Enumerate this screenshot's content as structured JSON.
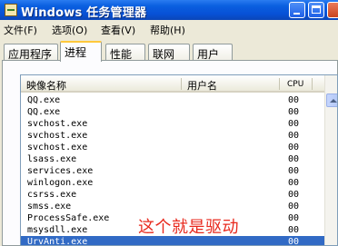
{
  "window": {
    "title": "Windows 任务管理器"
  },
  "menu": [
    {
      "label": "文件(F)"
    },
    {
      "label": "选项(O)"
    },
    {
      "label": "查看(V)"
    },
    {
      "label": "帮助(H)"
    }
  ],
  "tabs": [
    {
      "label": "应用程序"
    },
    {
      "label": "进程",
      "active": true
    },
    {
      "label": "性能"
    },
    {
      "label": "联网"
    },
    {
      "label": "用户"
    }
  ],
  "columns": {
    "image_name": "映像名称",
    "user_name": "用户名",
    "cpu": "CPU"
  },
  "processes": [
    {
      "name": "QQ.exe",
      "cpu": "00"
    },
    {
      "name": "QQ.exe",
      "cpu": "00"
    },
    {
      "name": "svchost.exe",
      "cpu": "00"
    },
    {
      "name": "svchost.exe",
      "cpu": "00"
    },
    {
      "name": "svchost.exe",
      "cpu": "00"
    },
    {
      "name": "lsass.exe",
      "cpu": "00"
    },
    {
      "name": "services.exe",
      "cpu": "00"
    },
    {
      "name": "winlogon.exe",
      "cpu": "00"
    },
    {
      "name": "csrss.exe",
      "cpu": "00"
    },
    {
      "name": "smss.exe",
      "cpu": "00"
    },
    {
      "name": "ProcessSafe.exe",
      "cpu": "00"
    },
    {
      "name": "msysdll.exe",
      "cpu": "00"
    },
    {
      "name": "UrvAnti.exe",
      "cpu": "00",
      "selected": true
    }
  ],
  "annotation": {
    "text": "这个就是驱动",
    "color": "#e8291d"
  },
  "colors": {
    "titlebar": "#0a5fe0",
    "selection": "#316ac5"
  }
}
